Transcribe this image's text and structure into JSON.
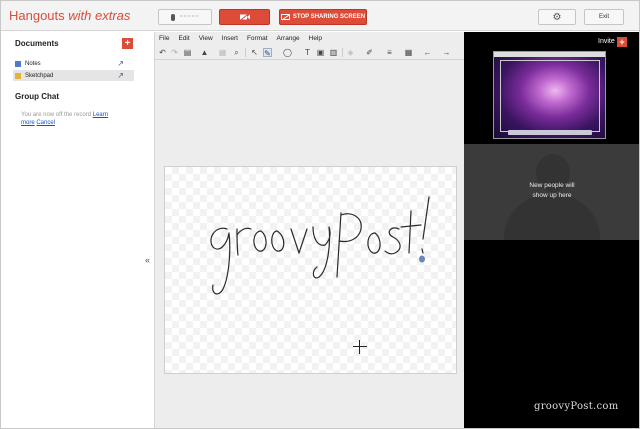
{
  "header": {
    "app_name": "Hangouts",
    "app_name_suffix": "with extras",
    "mic_level": "=====",
    "stop_sharing_label": "STOP SHARING SCREEN",
    "exit_label": "Exit",
    "accent_color": "#dd4b39"
  },
  "left_panel": {
    "documents_title": "Documents",
    "documents": [
      {
        "label": "Notes",
        "icon": "notes-icon"
      },
      {
        "label": "Sketchpad",
        "icon": "sketchpad-icon",
        "selected": true
      }
    ],
    "group_chat_title": "Group Chat",
    "group_chat_text": "You are now off the record",
    "learn_more_label": "Learn more",
    "cancel_label": "Cancel",
    "collapse_symbol": "«"
  },
  "sketchpad": {
    "menu": [
      "File",
      "Edit",
      "View",
      "Insert",
      "Format",
      "Arrange",
      "Help"
    ],
    "drawing_text": "groovyPost!"
  },
  "right_panel": {
    "invite_label": "Invite",
    "new_people_text_line1": "New people will",
    "new_people_text_line2": "show up here",
    "watermark": "groovyPost.com"
  }
}
